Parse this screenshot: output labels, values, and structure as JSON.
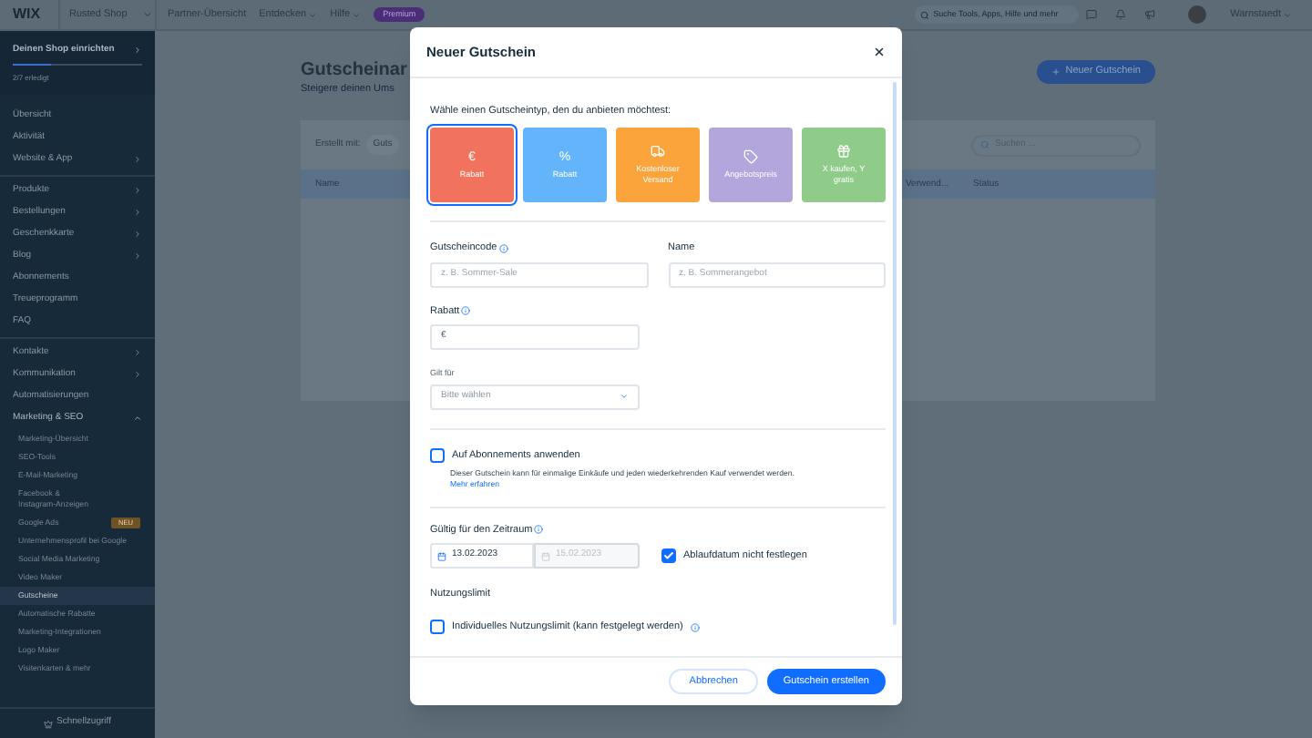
{
  "top_bar": {
    "logo": "WIX",
    "site": "Rusted Shop",
    "nav": [
      {
        "label": "Partner-Übersicht",
        "dropdown": false
      },
      {
        "label": "Entdecken",
        "dropdown": true
      },
      {
        "label": "Hilfe",
        "dropdown": true
      }
    ],
    "badge": "Premium",
    "search": {
      "placeholder": "Suche Tools, Apps, Hilfe und mehr"
    },
    "user": "Warnstaedt"
  },
  "sidebar": {
    "setup": {
      "title": "Deinen Shop einrichten",
      "progress": "2/7 erledigt",
      "level": 0.29
    },
    "sections": [
      {
        "items": [
          {
            "label": "Übersicht",
            "expandable": false,
            "selected": false
          },
          {
            "label": "Aktivität",
            "expandable": false,
            "selected": false
          },
          {
            "label": "Website & App",
            "expandable": true,
            "selected": false
          }
        ]
      },
      {
        "items": [
          {
            "label": "Produkte",
            "expandable": true,
            "selected": false
          },
          {
            "label": "Bestellungen",
            "expandable": true,
            "selected": false
          },
          {
            "label": "Geschenkkarte",
            "expandable": true,
            "selected": false
          },
          {
            "label": "Blog",
            "expandable": true,
            "selected": false
          },
          {
            "label": "Abonnements",
            "expandable": false,
            "selected": false
          },
          {
            "label": "Treueprogramm",
            "expandable": false,
            "selected": false
          },
          {
            "label": "FAQ",
            "expandable": false,
            "selected": false
          }
        ]
      },
      {
        "items": [
          {
            "label": "Kontakte",
            "expandable": true,
            "selected": false
          },
          {
            "label": "Kommunikation",
            "expandable": true,
            "selected": false
          },
          {
            "label": "Automatisierungen",
            "expandable": false,
            "selected": false
          },
          {
            "label": "Marketing & SEO",
            "expandable": true,
            "expanded": true,
            "selected": false,
            "children": [
              {
                "label": "Marketing-Übersicht",
                "selected": false
              },
              {
                "label": "SEO-Tools",
                "selected": false
              },
              {
                "label": "E-Mail-Marketing",
                "selected": false
              },
              {
                "label": "Facebook &\nInstagram-Anzeigen",
                "selected": false
              },
              {
                "label": "Google Ads",
                "badge": "NEU",
                "selected": false
              },
              {
                "label": "Unternehmensprofil bei Google",
                "selected": false
              },
              {
                "label": "Social Media Marketing",
                "selected": false
              },
              {
                "label": "Video Maker",
                "selected": false
              },
              {
                "label": "Gutscheine",
                "selected": true
              },
              {
                "label": "Automatische Rabatte",
                "selected": false
              },
              {
                "label": "Marketing-Integrationen",
                "selected": false
              },
              {
                "label": "Logo Maker",
                "selected": false
              },
              {
                "label": "Visitenkarten & mehr",
                "selected": false
              }
            ]
          }
        ]
      }
    ],
    "quick_access": "Schnellzugriff"
  },
  "page": {
    "title": "Gutscheinar",
    "subtitle": "Steigere deinen Ums",
    "new_button": "Neuer Gutschein",
    "filter_label": "Erstellt mit:",
    "filter_value": "Guts",
    "search": {
      "placeholder": "Suchen ..."
    },
    "table": {
      "columns": [
        "Name",
        "Verwend...",
        "Status"
      ]
    }
  },
  "modal": {
    "title": "Neuer Gutschein",
    "prompt": "Wähle einen Gutscheintyp, den du anbieten möchtest:",
    "types": [
      {
        "kind": "symbol",
        "symbol": "€",
        "label": "Rabatt",
        "color": "#f2735d",
        "selected": true
      },
      {
        "kind": "symbol",
        "symbol": "%",
        "label": "Rabatt",
        "color": "#64b4fb",
        "selected": false
      },
      {
        "kind": "shipping",
        "label": "Kostenloser Versand",
        "color": "#fca43c",
        "selected": false
      },
      {
        "kind": "price",
        "label": "Angebotspreis",
        "color": "#b3a6dd",
        "selected": false
      },
      {
        "kind": "bundle",
        "label": "X kaufen, Y gratis",
        "color": "#8fcc8a",
        "selected": false
      }
    ],
    "code": {
      "label": "Gutscheincode",
      "placeholder": "z. B. Sommer-Sale"
    },
    "name": {
      "label": "Name",
      "placeholder": "z. B. Sommerangebot"
    },
    "discount": {
      "label": "Rabatt",
      "prefix": "€"
    },
    "applies_to": {
      "label": "Gilt für",
      "value": "Bitte wählen"
    },
    "subscriptions": {
      "label": "Auf Abonnements anwenden",
      "checked": false,
      "description": "Dieser Gutschein kann für einmalige Einkäufe und jeden wiederkehrenden Kauf verwendet werden.",
      "link": "Mehr erfahren"
    },
    "period": {
      "label": "Gültig für den Zeitraum",
      "start": "13.02.2023",
      "end": "15.02.2023",
      "end_disabled": true,
      "no_expiry": {
        "label": "Ablaufdatum nicht festlegen",
        "checked": true
      }
    },
    "limit": {
      "label": "Nutzungslimit",
      "option": {
        "label": "Individuelles Nutzungslimit (kann festgelegt werden)",
        "checked": false
      }
    },
    "buttons": {
      "cancel": "Abbrechen",
      "create": "Gutschein erstellen"
    }
  }
}
